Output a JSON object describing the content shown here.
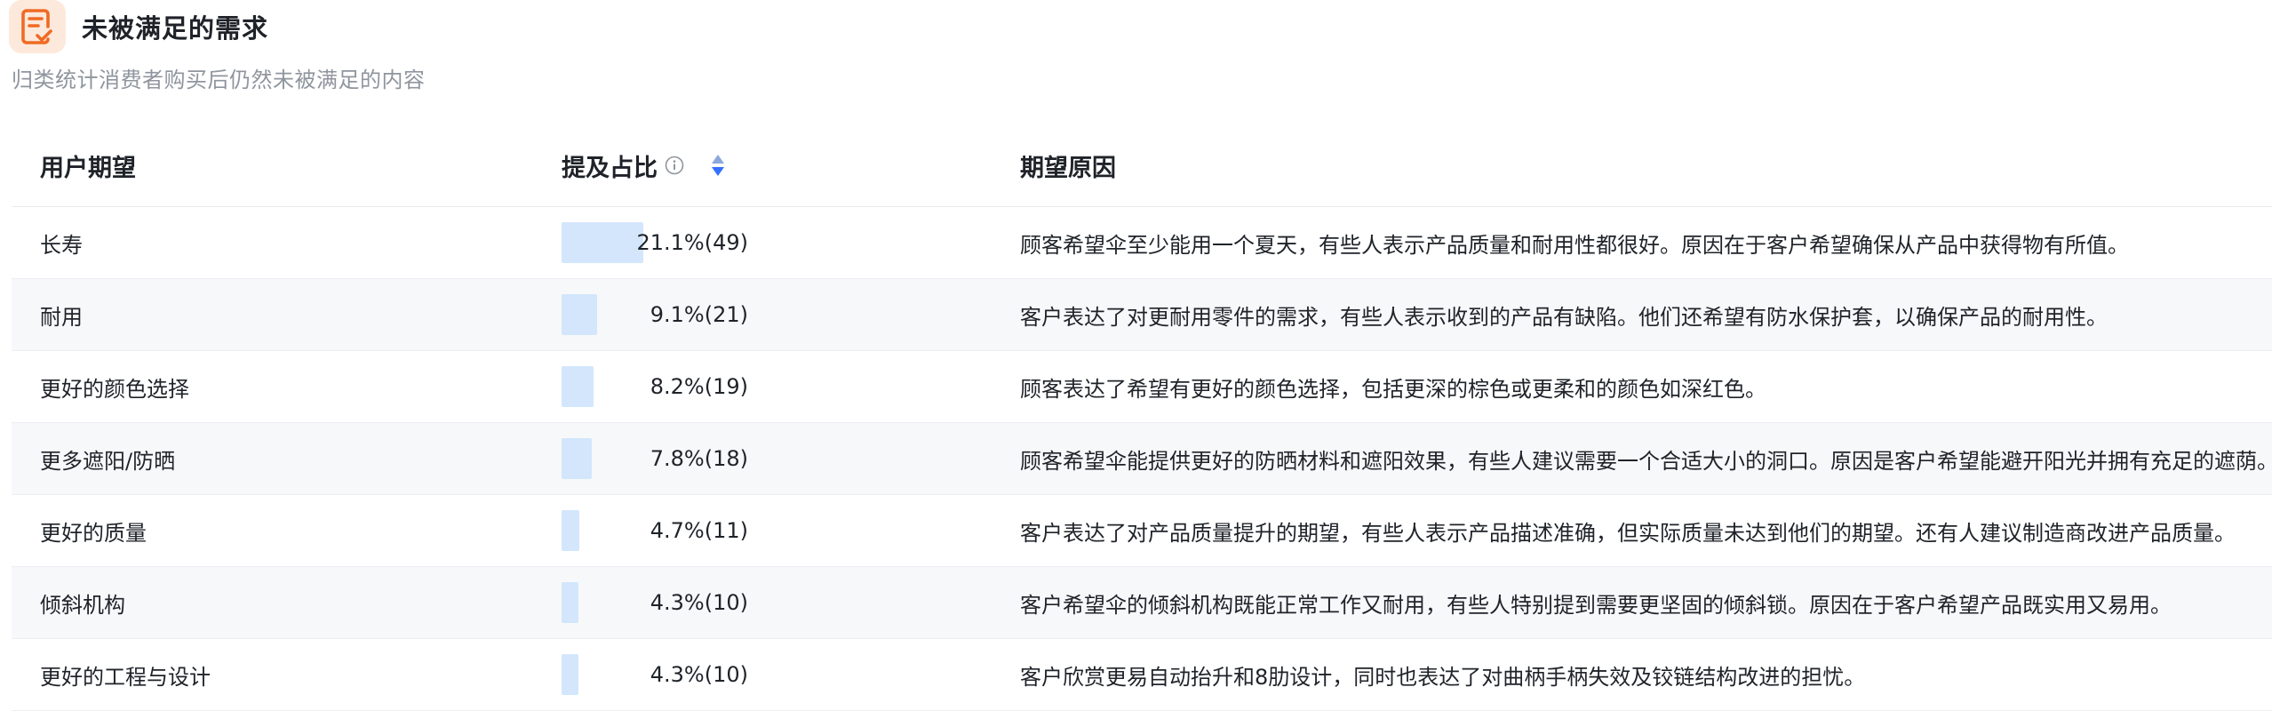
{
  "header": {
    "title": "未被满足的需求",
    "subtitle": "归类统计消费者购买后仍然未被满足的内容",
    "icon": "document-check-icon",
    "icon_color": "#f06a24"
  },
  "table": {
    "columns": {
      "expectation": "用户期望",
      "ratio": "提及占比",
      "reason": "期望原因"
    },
    "bar_color": "#d3e6fb",
    "rows": [
      {
        "expectation": "长寿",
        "share": 21.1,
        "ratio_text": "21.1%(49)",
        "reason": "顾客希望伞至少能用一个夏天，有些人表示产品质量和耐用性都很好。原因在于客户希望确保从产品中获得物有所值。"
      },
      {
        "expectation": "耐用",
        "share": 9.1,
        "ratio_text": "9.1%(21)",
        "reason": "客户表达了对更耐用零件的需求，有些人表示收到的产品有缺陷。他们还希望有防水保护套，以确保产品的耐用性。"
      },
      {
        "expectation": "更好的颜色选择",
        "share": 8.2,
        "ratio_text": "8.2%(19)",
        "reason": "顾客表达了希望有更好的颜色选择，包括更深的棕色或更柔和的颜色如深红色。"
      },
      {
        "expectation": "更多遮阳/防晒",
        "share": 7.8,
        "ratio_text": "7.8%(18)",
        "reason": "顾客希望伞能提供更好的防晒材料和遮阳效果，有些人建议需要一个合适大小的洞口。原因是客户希望能避开阳光并拥有充足的遮荫。"
      },
      {
        "expectation": "更好的质量",
        "share": 4.7,
        "ratio_text": "4.7%(11)",
        "reason": "客户表达了对产品质量提升的期望，有些人表示产品描述准确，但实际质量未达到他们的期望。还有人建议制造商改进产品质量。"
      },
      {
        "expectation": "倾斜机构",
        "share": 4.3,
        "ratio_text": "4.3%(10)",
        "reason": "客户希望伞的倾斜机构既能正常工作又耐用，有些人特别提到需要更坚固的倾斜锁。原因在于客户希望产品既实用又易用。"
      },
      {
        "expectation": "更好的工程与设计",
        "share": 4.3,
        "ratio_text": "4.3%(10)",
        "reason": "客户欣赏更易自动抬升和8肋设计，同时也表达了对曲柄手柄失效及铰链结构改进的担忧。"
      }
    ]
  }
}
